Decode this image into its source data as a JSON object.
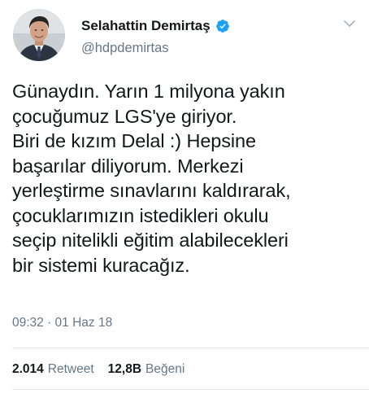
{
  "author": {
    "display_name": "Selahattin Demirtaş",
    "handle": "@hdpdemirtas",
    "verified": true,
    "verified_color": "#1da1f2"
  },
  "tweet": {
    "lines": [
      "Günaydın. Yarın 1 milyona yakın",
      "çocuğumuz LGS'ye giriyor.",
      "Biri de kızım Delal :) Hepsine",
      "başarılar diliyorum. Merkezi",
      "yerleştirme sınavlarını kaldırarak,",
      "çocuklarımızın istedikleri okulu",
      "seçip nitelikli eğitim alabilecekleri",
      "bir sistemi kuracağız."
    ],
    "timestamp": "09:32 · 01 Haz 18"
  },
  "stats": {
    "retweets_count": "2.014",
    "retweets_label": "Retweet",
    "likes_count": "12,8B",
    "likes_label": "Beğeni"
  },
  "icons": {
    "verified": "verified-badge-icon",
    "menu": "chevron-down-icon"
  }
}
